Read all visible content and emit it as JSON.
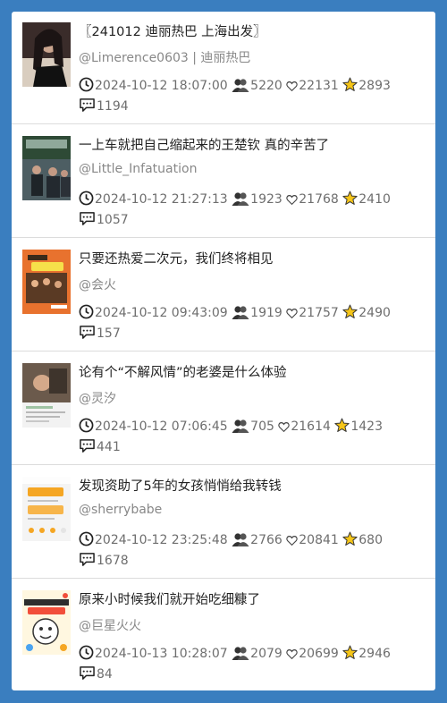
{
  "items": [
    {
      "title": "〖241012 迪丽热巴 上海出发〗",
      "author": "@Limerence0603 | 迪丽热巴",
      "time": "2024-10-12 18:07:00",
      "views": "5220",
      "likes": "22131",
      "stars": "2893",
      "comments": "1194"
    },
    {
      "title": "一上车就把自己缩起来的王楚钦 真的辛苦了",
      "author": "@Little_Infatuation",
      "time": "2024-10-12 21:27:13",
      "views": "1923",
      "likes": "21768",
      "stars": "2410",
      "comments": "1057"
    },
    {
      "title": "只要还热爱二次元，我们终将相见",
      "author": "@会火",
      "time": "2024-10-12 09:43:09",
      "views": "1919",
      "likes": "21757",
      "stars": "2490",
      "comments": "157"
    },
    {
      "title": "论有个“不解风情”的老婆是什么体验",
      "author": "@灵汐",
      "time": "2024-10-12 07:06:45",
      "views": "705",
      "likes": "21614",
      "stars": "1423",
      "comments": "441"
    },
    {
      "title": "发现资助了5年的女孩悄悄给我转钱",
      "author": "@sherrybabe",
      "time": "2024-10-12 23:25:48",
      "views": "2766",
      "likes": "20841",
      "stars": "680",
      "comments": "1678"
    },
    {
      "title": "原来小时候我们就开始吃细糠了",
      "author": "@巨星火火",
      "time": "2024-10-13 10:28:07",
      "views": "2079",
      "likes": "20699",
      "stars": "2946",
      "comments": "84"
    }
  ],
  "icons": {
    "time": "clock-icon",
    "views": "people-icon",
    "likes": "heart-icon",
    "stars": "star-icon",
    "comments": "comment-icon"
  },
  "colors": {
    "background": "#3a7ebf",
    "star": "#f5c518"
  }
}
